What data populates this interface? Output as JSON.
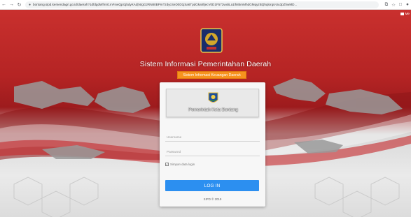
{
  "browser": {
    "back_icon": "back-arrow-icon",
    "forward_icon": "forward-arrow-icon",
    "reload_icon": "reload-icon",
    "url": "bontang.sipd.kemendagri.go.id/daerah?1dfdgdWfmIr1mFnwQpI1jbdyKAd|N/gG2RN80BPmTzdycSeD0D1jSa6TpdGkahfjecV0D1F572wxliLa1lh85mMhdGMqyzBQhqlorg/vUu3pZhwMD...",
    "toolbar_icons": [
      "share-icon",
      "star-icon",
      "extension-icon",
      "profile-icon"
    ],
    "corner_badge": "Me"
  },
  "header": {
    "title": "Sistem Informasi Pemerintahan Daerah",
    "subtitle": "Sistem Informasi Keuangan Daerah"
  },
  "login": {
    "org_name": "Pemerintah Kota Bontang",
    "username_placeholder": "Username",
    "password_placeholder": "Password",
    "remember_label": "Simpan data login",
    "remember_checked": true,
    "login_button": "LOG IN",
    "footer": "SIPD © 2019"
  },
  "colors": {
    "primary_red": "#b52424",
    "accent_orange": "#f7931e",
    "login_blue": "#2c8ff0",
    "card_bg": "#f7f7f7"
  }
}
